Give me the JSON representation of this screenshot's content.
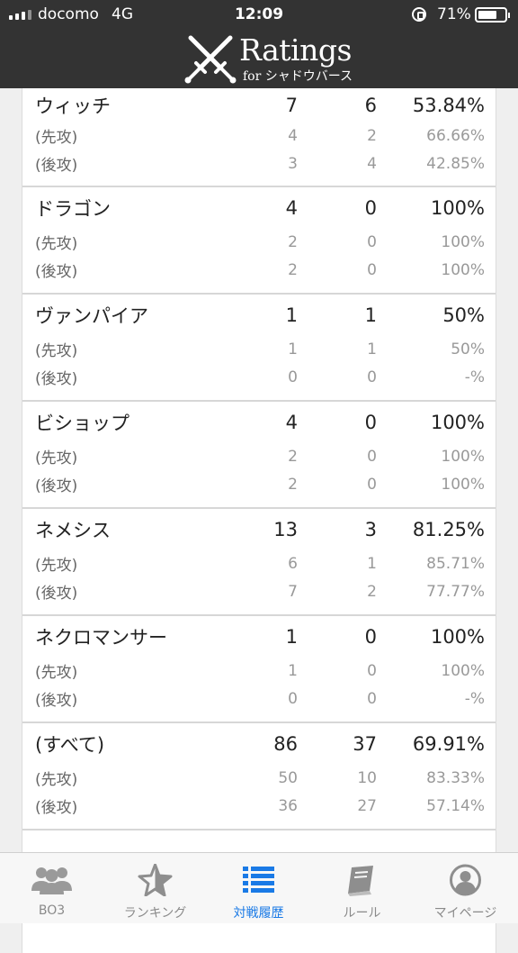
{
  "status_bar": {
    "carrier": "docomo",
    "network": "4G",
    "time": "12:09",
    "battery": "71%",
    "battery_level": 0.71
  },
  "header": {
    "logo_title": "Ratings",
    "logo_sub": "for シャドウバース"
  },
  "table": {
    "groups": [
      {
        "name": "ウィッチ",
        "w": "7",
        "l": "6",
        "rate": "53.84%",
        "first": {
          "label": "(先攻)",
          "w": "4",
          "l": "2",
          "rate": "66.66%"
        },
        "second": {
          "label": "(後攻)",
          "w": "3",
          "l": "4",
          "rate": "42.85%"
        }
      },
      {
        "name": "ドラゴン",
        "w": "4",
        "l": "0",
        "rate": "100%",
        "first": {
          "label": "(先攻)",
          "w": "2",
          "l": "0",
          "rate": "100%"
        },
        "second": {
          "label": "(後攻)",
          "w": "2",
          "l": "0",
          "rate": "100%"
        }
      },
      {
        "name": "ヴァンパイア",
        "w": "1",
        "l": "1",
        "rate": "50%",
        "first": {
          "label": "(先攻)",
          "w": "1",
          "l": "1",
          "rate": "50%"
        },
        "second": {
          "label": "(後攻)",
          "w": "0",
          "l": "0",
          "rate": "-%"
        }
      },
      {
        "name": "ビショップ",
        "w": "4",
        "l": "0",
        "rate": "100%",
        "first": {
          "label": "(先攻)",
          "w": "2",
          "l": "0",
          "rate": "100%"
        },
        "second": {
          "label": "(後攻)",
          "w": "2",
          "l": "0",
          "rate": "100%"
        }
      },
      {
        "name": "ネメシス",
        "w": "13",
        "l": "3",
        "rate": "81.25%",
        "first": {
          "label": "(先攻)",
          "w": "6",
          "l": "1",
          "rate": "85.71%"
        },
        "second": {
          "label": "(後攻)",
          "w": "7",
          "l": "2",
          "rate": "77.77%"
        }
      },
      {
        "name": "ネクロマンサー",
        "w": "1",
        "l": "0",
        "rate": "100%",
        "first": {
          "label": "(先攻)",
          "w": "1",
          "l": "0",
          "rate": "100%"
        },
        "second": {
          "label": "(後攻)",
          "w": "0",
          "l": "0",
          "rate": "-%"
        }
      },
      {
        "name": "(すべて)",
        "w": "86",
        "l": "37",
        "rate": "69.91%",
        "first": {
          "label": "(先攻)",
          "w": "50",
          "l": "10",
          "rate": "83.33%"
        },
        "second": {
          "label": "(後攻)",
          "w": "36",
          "l": "27",
          "rate": "57.14%"
        }
      }
    ]
  },
  "tabbar": {
    "tabs": [
      {
        "label": "BO3",
        "icon": "users-icon"
      },
      {
        "label": "ランキング",
        "icon": "star-icon"
      },
      {
        "label": "対戦履歴",
        "icon": "list-icon",
        "active": true
      },
      {
        "label": "ルール",
        "icon": "book-icon"
      },
      {
        "label": "マイページ",
        "icon": "user-circle-icon"
      }
    ]
  },
  "colors": {
    "header_bg": "#333333",
    "active_tab": "#1a7ae6",
    "inactive_tab": "#8a8a8a"
  }
}
